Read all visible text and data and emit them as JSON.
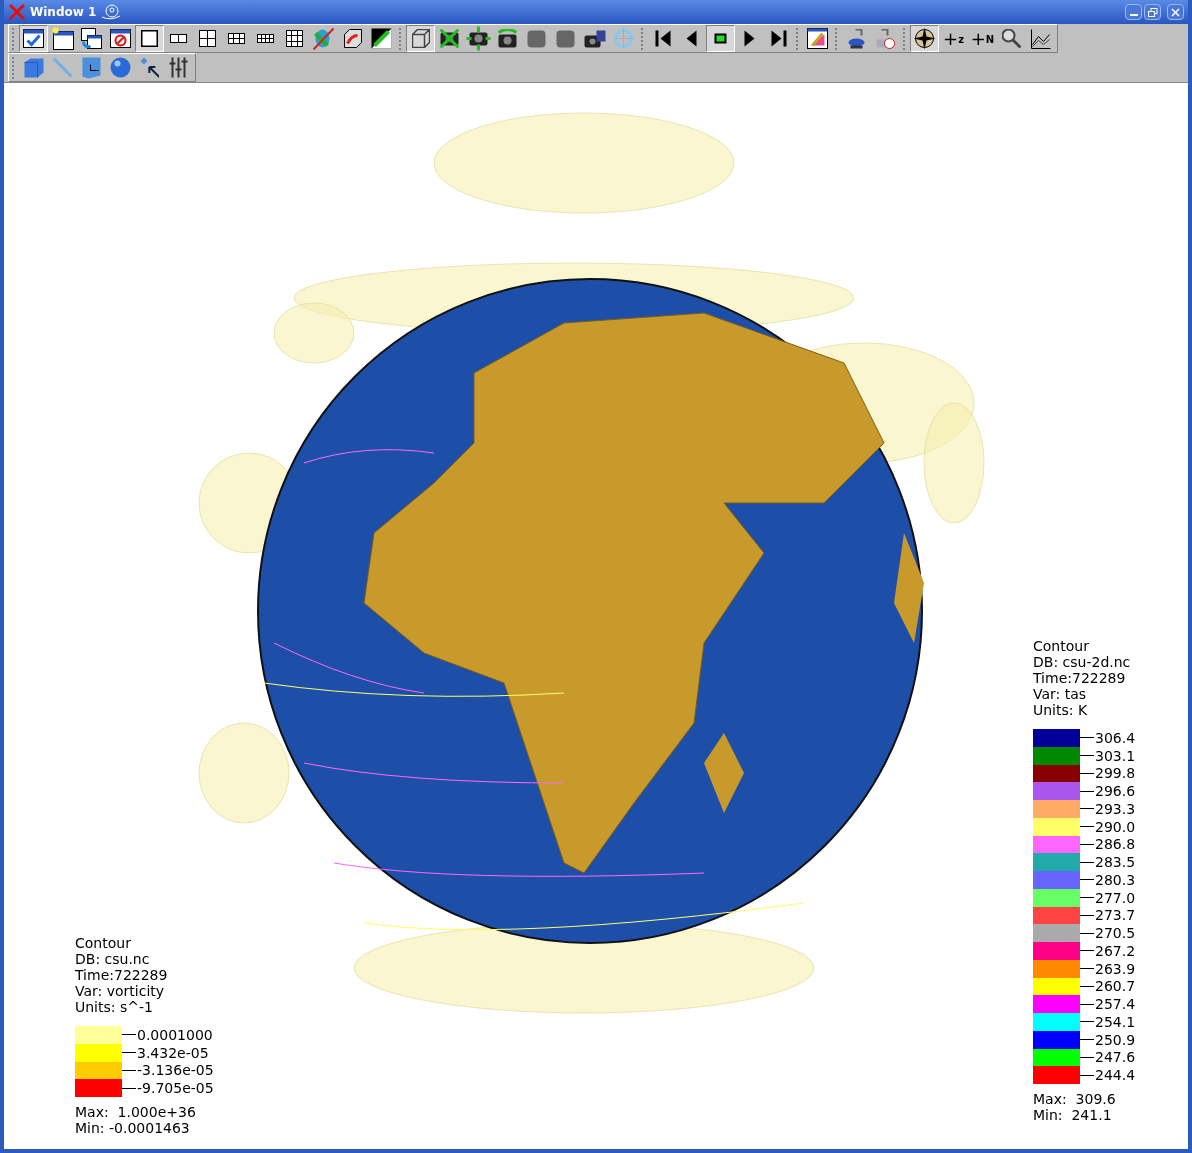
{
  "window": {
    "title": "Window 1"
  },
  "toolbars": [
    {
      "groups": [
        [
          {
            "kind": "window-check",
            "pressed": true
          },
          {
            "kind": "window-new",
            "pressed": false
          },
          {
            "kind": "window-copy",
            "pressed": false
          },
          {
            "kind": "window-delete",
            "pressed": false
          },
          {
            "kind": "layout-single",
            "pressed": true
          },
          {
            "kind": "layout-two",
            "pressed": false
          },
          {
            "kind": "layout-four",
            "pressed": false
          },
          {
            "kind": "layout-six",
            "pressed": false
          },
          {
            "kind": "layout-eight",
            "pressed": false
          },
          {
            "kind": "layout-nine",
            "pressed": false
          },
          {
            "kind": "crossed-cylinder",
            "pressed": false
          },
          {
            "kind": "cube-arrow",
            "pressed": false
          },
          {
            "kind": "split-arrows",
            "pressed": false
          }
        ],
        [
          {
            "kind": "cube",
            "pressed": true
          },
          {
            "kind": "camera-crossed",
            "pressed": false
          },
          {
            "kind": "camera-arrows",
            "pressed": false
          },
          {
            "kind": "camera-rotate",
            "pressed": false
          },
          {
            "kind": "blob",
            "pressed": false
          },
          {
            "kind": "blob",
            "pressed": false
          },
          {
            "kind": "camera-disk",
            "pressed": false
          },
          {
            "kind": "crosshair-rotate",
            "pressed": false
          }
        ],
        [
          {
            "kind": "step-back",
            "pressed": false
          },
          {
            "kind": "reverse",
            "pressed": false
          },
          {
            "kind": "stop",
            "pressed": true
          },
          {
            "kind": "play",
            "pressed": false
          },
          {
            "kind": "step-forward",
            "pressed": false
          }
        ],
        [
          {
            "kind": "palette-window",
            "pressed": false
          }
        ],
        [
          {
            "kind": "lamp",
            "pressed": false
          },
          {
            "kind": "lamp-clock",
            "pressed": false
          }
        ],
        [
          {
            "kind": "compass",
            "pressed": true
          },
          {
            "kind": "text",
            "text": "+",
            "sub": "z",
            "pressed": false
          },
          {
            "kind": "text",
            "text": "+",
            "sub": "N",
            "pressed": false
          },
          {
            "kind": "magnifier",
            "pressed": false
          },
          {
            "kind": "chart",
            "pressed": false
          }
        ]
      ]
    },
    {
      "groups": [
        [
          {
            "kind": "cube-solid",
            "pressed": false
          },
          {
            "kind": "line",
            "pressed": false
          },
          {
            "kind": "plane",
            "pressed": false
          },
          {
            "kind": "sphere",
            "pressed": false
          },
          {
            "kind": "pointer",
            "pressed": false
          },
          {
            "kind": "sliders",
            "pressed": false
          }
        ]
      ]
    }
  ],
  "legends": [
    {
      "lines": [
        "Contour",
        "DB: csu.nc",
        "Time:722289",
        "Var: vorticity",
        "Units: s^-1"
      ],
      "entries": [
        {
          "label": "0.0001000",
          "color": "#ffff99"
        },
        {
          "label": "3.432e-05",
          "color": "#ffff00"
        },
        {
          "label": "-3.136e-05",
          "color": "#ffcc00"
        },
        {
          "label": "-9.705e-05",
          "color": "#ff0000"
        }
      ],
      "max": "Max:  1.000e+36",
      "min": "Min: -0.0001463"
    },
    {
      "lines": [
        "Contour",
        "DB: csu-2d.nc",
        "Time:722289",
        "Var: tas",
        "Units: K"
      ],
      "entries": [
        {
          "label": "306.4",
          "color": "#000099"
        },
        {
          "label": "303.1",
          "color": "#008800"
        },
        {
          "label": "299.8",
          "color": "#880000"
        },
        {
          "label": "296.6",
          "color": "#aa55ee"
        },
        {
          "label": "293.3",
          "color": "#ffaa66"
        },
        {
          "label": "290.0",
          "color": "#ffff66"
        },
        {
          "label": "286.8",
          "color": "#ff66ff"
        },
        {
          "label": "283.5",
          "color": "#22aaaa"
        },
        {
          "label": "280.3",
          "color": "#6666ff"
        },
        {
          "label": "277.0",
          "color": "#66ff66"
        },
        {
          "label": "273.7",
          "color": "#ff4444"
        },
        {
          "label": "270.5",
          "color": "#aaaaaa"
        },
        {
          "label": "267.2",
          "color": "#ff0088"
        },
        {
          "label": "263.9",
          "color": "#ff8800"
        },
        {
          "label": "260.7",
          "color": "#ffff00"
        },
        {
          "label": "257.4",
          "color": "#ff00ff"
        },
        {
          "label": "254.1",
          "color": "#00ffff"
        },
        {
          "label": "250.9",
          "color": "#0000ff"
        },
        {
          "label": "247.6",
          "color": "#00ff00"
        },
        {
          "label": "244.4",
          "color": "#ff0000"
        }
      ],
      "max": "Max:  309.6",
      "min": "Min:  241.1"
    }
  ]
}
